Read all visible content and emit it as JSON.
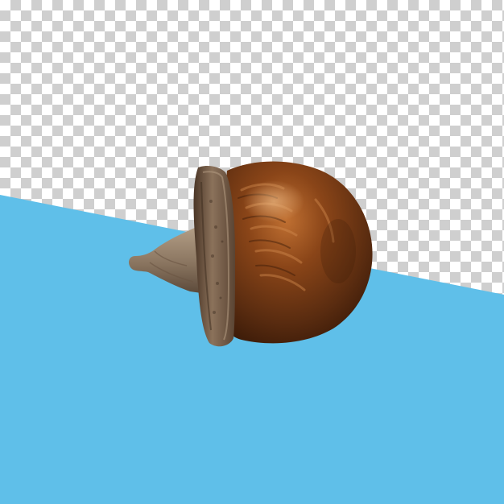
{
  "scene": {
    "subject": "acorn",
    "background": "transparency-checkerboard",
    "colors": {
      "checker_light": "#ffffff",
      "checker_dark": "#cfcfcf",
      "blue_panel": "#5fbfe9",
      "nut_dark": "#4b2610",
      "nut_mid": "#7a3d14",
      "nut_light": "#b0632a",
      "cap_dark": "#4f3b2c",
      "cap_mid": "#7c644f",
      "cap_light": "#a58b73"
    }
  }
}
